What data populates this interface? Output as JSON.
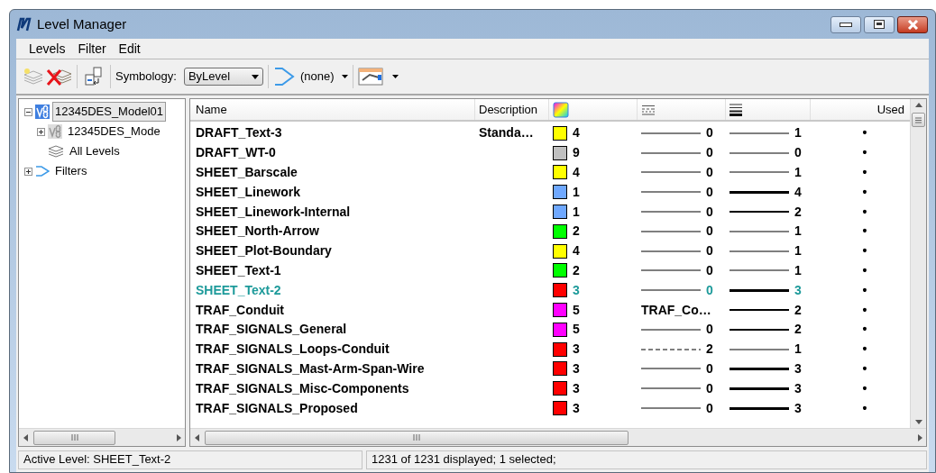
{
  "window": {
    "title": "Level Manager"
  },
  "menu": [
    "Levels",
    "Filter",
    "Edit"
  ],
  "toolbar": {
    "symbology_label": "Symbology:",
    "symbology_value": "ByLevel",
    "filter_value": "(none)"
  },
  "tree": [
    {
      "label": "12345DES_Model01",
      "kind": "model",
      "selected": true,
      "expanded": true,
      "children": [
        {
          "label": "12345DES_Mode",
          "kind": "model",
          "selected": false,
          "expanded": false
        },
        {
          "label": "All Levels",
          "kind": "levels",
          "selected": false
        }
      ]
    },
    {
      "label": "Filters",
      "kind": "filter",
      "selected": false,
      "expanded": false
    }
  ],
  "table": {
    "columns": [
      "Name",
      "Description",
      "Used"
    ],
    "rows": [
      {
        "name": "DRAFT_Text-3",
        "description": "Standa…",
        "color": "#ffff00",
        "color_number": "4",
        "kind": "solid",
        "style": "0",
        "weight": "1",
        "used": "•",
        "active": false
      },
      {
        "name": "DRAFT_WT-0",
        "color": "#c0c0c0",
        "color_number": "9",
        "kind": "solid",
        "style": "0",
        "weight": "0",
        "used": "•",
        "active": false
      },
      {
        "name": "SHEET_Barscale",
        "color": "#ffff00",
        "color_number": "4",
        "kind": "solid",
        "style": "0",
        "weight": "1",
        "used": "•",
        "active": false
      },
      {
        "name": "SHEET_Linework",
        "color": "#6fa8ff",
        "color_number": "1",
        "kind": "solid",
        "style": "0",
        "weight": "4",
        "used": "•",
        "active": false
      },
      {
        "name": "SHEET_Linework-Internal",
        "color": "#6fa8ff",
        "color_number": "1",
        "kind": "solid",
        "style": "0",
        "weight": "2",
        "used": "•",
        "active": false
      },
      {
        "name": "SHEET_North-Arrow",
        "color": "#00ff00",
        "color_number": "2",
        "kind": "solid",
        "style": "0",
        "weight": "1",
        "used": "•",
        "active": false
      },
      {
        "name": "SHEET_Plot-Boundary",
        "color": "#ffff00",
        "color_number": "4",
        "kind": "solid",
        "style": "0",
        "weight": "1",
        "used": "•",
        "active": false
      },
      {
        "name": "SHEET_Text-1",
        "color": "#00ff00",
        "color_number": "2",
        "kind": "solid",
        "style": "0",
        "weight": "1",
        "used": "•",
        "active": false
      },
      {
        "name": "SHEET_Text-2",
        "color": "#ff0000",
        "color_number": "3",
        "kind": "solid",
        "style": "0",
        "weight": "3",
        "used": "•",
        "active": true
      },
      {
        "name": "TRAF_Conduit",
        "color": "#ff00ff",
        "color_number": "5",
        "kind": "named",
        "style": "TRAF_Co…",
        "weight": "2",
        "used": "•",
        "active": false
      },
      {
        "name": "TRAF_SIGNALS_General",
        "color": "#ff00ff",
        "color_number": "5",
        "kind": "solid",
        "style": "0",
        "weight": "2",
        "used": "•",
        "active": false
      },
      {
        "name": "TRAF_SIGNALS_Loops-Conduit",
        "color": "#ff0000",
        "color_number": "3",
        "kind": "dashed",
        "style": "2",
        "weight": "1",
        "used": "•",
        "active": false
      },
      {
        "name": "TRAF_SIGNALS_Mast-Arm-Span-Wire",
        "color": "#ff0000",
        "color_number": "3",
        "kind": "solid",
        "style": "0",
        "weight": "3",
        "used": "•",
        "active": false
      },
      {
        "name": "TRAF_SIGNALS_Misc-Components",
        "color": "#ff0000",
        "color_number": "3",
        "kind": "solid",
        "style": "0",
        "weight": "3",
        "used": "•",
        "active": false
      },
      {
        "name": "TRAF_SIGNALS_Proposed",
        "color": "#ff0000",
        "color_number": "3",
        "kind": "solid",
        "style": "0",
        "weight": "3",
        "used": "•",
        "active": false
      }
    ]
  },
  "status_bar": [
    "Active Level: SHEET_Text-2",
    "1231 of 1231 displayed; 1 selected;"
  ]
}
